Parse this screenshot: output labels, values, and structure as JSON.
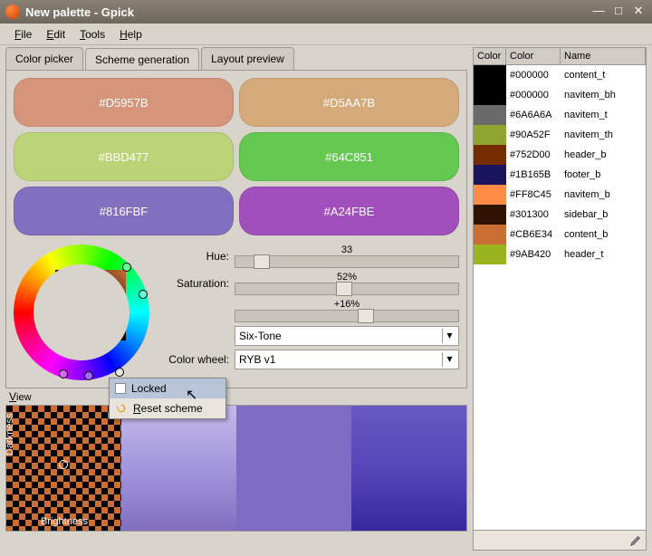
{
  "window": {
    "title": "New palette - Gpick"
  },
  "menu": {
    "file": "File",
    "edit": "Edit",
    "tools": "Tools",
    "help": "Help"
  },
  "tabs": {
    "picker": "Color picker",
    "scheme": "Scheme generation",
    "layout": "Layout preview"
  },
  "swatches": [
    {
      "hex": "#D5957B",
      "bg": "#d5957b"
    },
    {
      "hex": "#D5AA7B",
      "bg": "#d5aa7b"
    },
    {
      "hex": "#BBD477",
      "bg": "#bbd477"
    },
    {
      "hex": "#64C851",
      "bg": "#64c851"
    },
    {
      "hex": "#816FBF",
      "bg": "#816fbf"
    },
    {
      "hex": "#A24FBE",
      "bg": "#a24fbe"
    }
  ],
  "controls": {
    "hue_label": "Hue:",
    "hue_val": "33",
    "sat_label": "Saturation:",
    "sat_val": "52%",
    "light_label": "",
    "light_val": "+16%",
    "scheme_label": "",
    "scheme_val": "Six-Tone",
    "wheel_label": "Color wheel:",
    "wheel_val": "RYB v1"
  },
  "context": {
    "locked": "Locked",
    "reset": "Reset scheme"
  },
  "view_label": "View",
  "darkness": "Darkness",
  "brightness": "Brightness",
  "palette": {
    "headers": {
      "color": "Color",
      "colorhex": "Color",
      "name": "Name"
    },
    "rows": [
      {
        "sw": "#000000",
        "hex": "#000000",
        "name": "content_t"
      },
      {
        "sw": "#000000",
        "hex": "#000000",
        "name": "navitem_bh"
      },
      {
        "sw": "#6a6a6a",
        "hex": "#6A6A6A",
        "name": "navitem_t"
      },
      {
        "sw": "#90a52f",
        "hex": "#90A52F",
        "name": "navitem_th"
      },
      {
        "sw": "#752d00",
        "hex": "#752D00",
        "name": "header_b"
      },
      {
        "sw": "#1b165b",
        "hex": "#1B165B",
        "name": "footer_b"
      },
      {
        "sw": "#ff8c45",
        "hex": "#FF8C45",
        "name": "navitem_b"
      },
      {
        "sw": "#301300",
        "hex": "#301300",
        "name": "sidebar_b"
      },
      {
        "sw": "#cb6e34",
        "hex": "#CB6E34",
        "name": "content_b"
      },
      {
        "sw": "#9ab420",
        "hex": "#9AB420",
        "name": "header_t"
      }
    ]
  }
}
